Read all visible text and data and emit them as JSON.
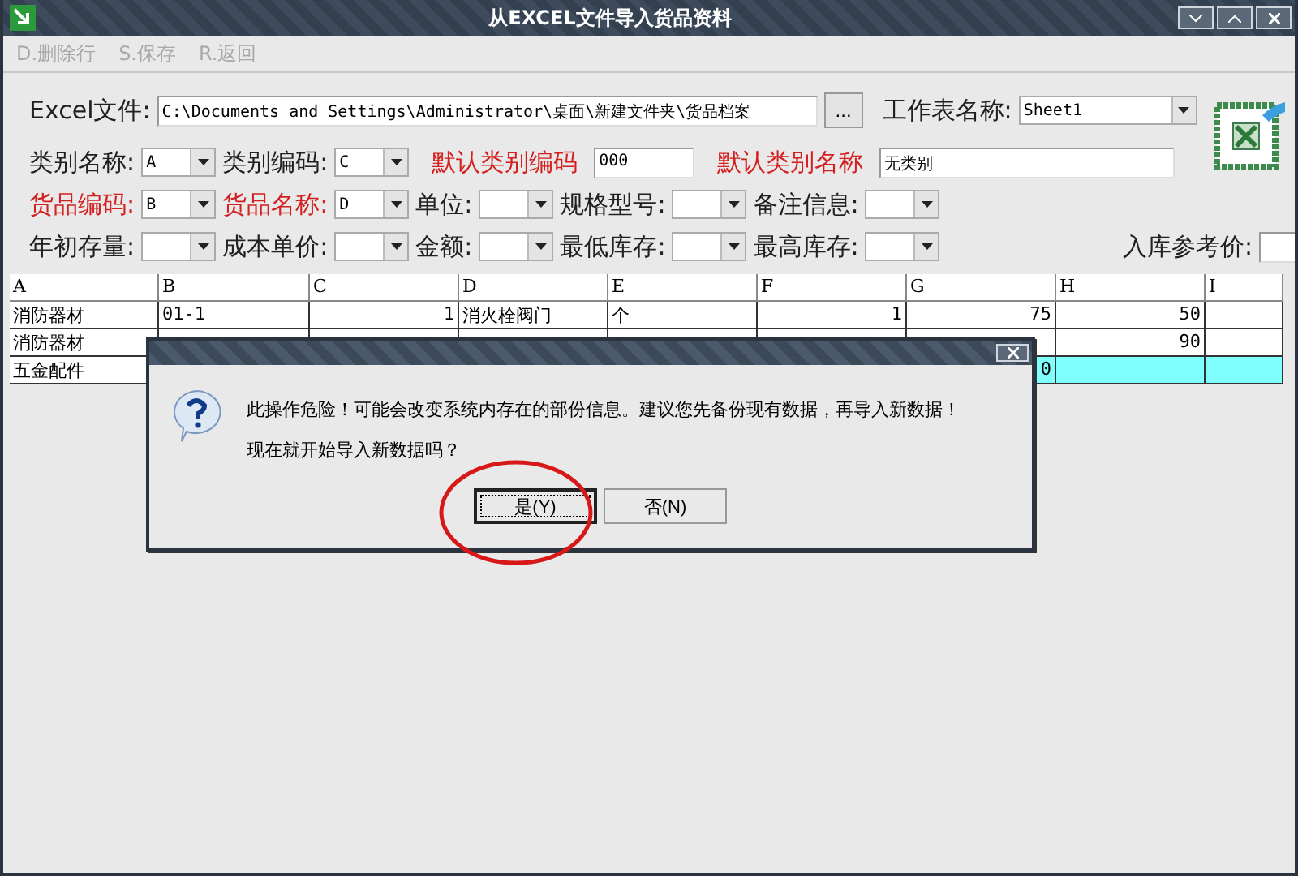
{
  "window": {
    "title": "从EXCEL文件导入货品资料"
  },
  "menu": [
    {
      "label": "D.删除行",
      "disabled": true
    },
    {
      "label": "S.保存",
      "disabled": true
    },
    {
      "label": "R.返回",
      "disabled": true
    }
  ],
  "file": {
    "label": "Excel文件:",
    "value": "C:\\Documents and Settings\\Administrator\\桌面\\新建文件夹\\货品档案",
    "browse": "...",
    "sheet_label": "工作表名称:",
    "sheet_value": "Sheet1"
  },
  "mapping_rows": [
    [
      {
        "kind": "select",
        "label": "类别名称:",
        "value": "A",
        "required": false
      },
      {
        "kind": "select",
        "label": "类别编码:",
        "value": "C",
        "required": false
      },
      {
        "kind": "text",
        "label": "默认类别编码",
        "value": "000",
        "required": true
      },
      {
        "kind": "wide",
        "label": "默认类别名称",
        "value": "无类别",
        "required": true
      }
    ],
    [
      {
        "kind": "select",
        "label": "货品编码:",
        "value": "B",
        "required": true
      },
      {
        "kind": "select",
        "label": "货品名称:",
        "value": "D",
        "required": true
      },
      {
        "kind": "select",
        "label": "单位:",
        "required": false
      },
      {
        "kind": "select",
        "label": "规格型号:",
        "required": false
      },
      {
        "kind": "select",
        "label": "备注信息:",
        "required": false
      }
    ],
    [
      {
        "kind": "select",
        "label": "年初存量:",
        "required": false
      },
      {
        "kind": "select",
        "label": "成本单价:",
        "required": false
      },
      {
        "kind": "select",
        "label": "金额:",
        "required": false
      },
      {
        "kind": "select",
        "label": "最低库存:",
        "required": false
      },
      {
        "kind": "select",
        "label": "最高库存:",
        "required": false
      },
      {
        "kind": "edge",
        "label": "入库参考价:",
        "required": false
      }
    ]
  ],
  "grid": {
    "columns": [
      {
        "label": "A",
        "numeric": false
      },
      {
        "label": "B",
        "numeric": false
      },
      {
        "label": "C",
        "numeric": true
      },
      {
        "label": "D",
        "numeric": false
      },
      {
        "label": "E",
        "numeric": false
      },
      {
        "label": "F",
        "numeric": true
      },
      {
        "label": "G",
        "numeric": true
      },
      {
        "label": "H",
        "numeric": true
      },
      {
        "label": "I"
      }
    ],
    "rows": [
      {
        "selected": false,
        "cells": [
          "消防器材",
          "01-1",
          "1",
          "消火栓阀门",
          "个",
          "1",
          "75",
          "50",
          ""
        ]
      },
      {
        "selected": false,
        "cells": [
          "消防器材",
          "",
          "",
          "",
          "",
          "",
          "",
          "90",
          ""
        ]
      },
      {
        "selected": true,
        "cells": [
          "五金配件",
          "",
          "",
          "",
          "",
          "",
          "0",
          "",
          ""
        ]
      }
    ]
  },
  "dialog": {
    "lines": [
      "此操作危险！可能会改变系统内存在的部份信息。建议您先备份现有数据，再导入新数据！",
      "现在就开始导入新数据吗？"
    ],
    "buttons": [
      {
        "label": "是(Y)",
        "focused": true
      },
      {
        "label": "否(N)",
        "focused": false
      }
    ]
  }
}
